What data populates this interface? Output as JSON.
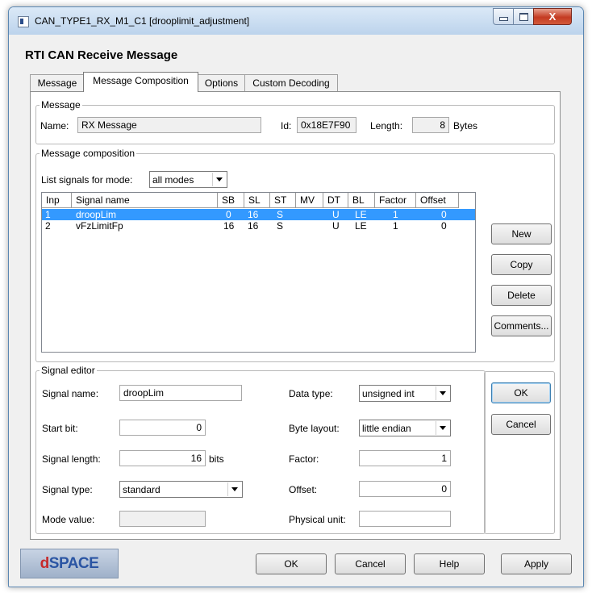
{
  "window": {
    "title": "CAN_TYPE1_RX_M1_C1  [drooplimit_adjustment]",
    "close_glyph": "X"
  },
  "heading": "RTI CAN  Receive Message",
  "tabs": [
    {
      "label": "Message"
    },
    {
      "label": "Message Composition",
      "active": true
    },
    {
      "label": "Options"
    },
    {
      "label": "Custom Decoding"
    }
  ],
  "message_group": {
    "legend": "Message",
    "name_label": "Name:",
    "name_value": "RX Message",
    "id_label": "Id:",
    "id_value": "0x18E7F90",
    "length_label": "Length:",
    "length_value": "8",
    "bytes_label": "Bytes"
  },
  "composition_group": {
    "legend": "Message composition",
    "mode_label": "List signals for mode:",
    "mode_value": "all modes",
    "columns": [
      "Inp",
      "Signal name",
      "SB",
      "SL",
      "ST",
      "MV",
      "DT",
      "BL",
      "Factor",
      "Offset"
    ],
    "rows": [
      {
        "inp": "1",
        "name": "droopLim",
        "sb": "0",
        "sl": "16",
        "st": "S",
        "mv": "",
        "dt": "U",
        "bl": "LE",
        "factor": "1",
        "offset": "0",
        "selected": true
      },
      {
        "inp": "2",
        "name": "vFzLimitFp",
        "sb": "16",
        "sl": "16",
        "st": "S",
        "mv": "",
        "dt": "U",
        "bl": "LE",
        "factor": "1",
        "offset": "0",
        "selected": false
      }
    ],
    "buttons": {
      "new": "New",
      "copy": "Copy",
      "delete": "Delete",
      "comments": "Comments..."
    }
  },
  "signal_editor": {
    "legend": "Signal editor",
    "signal_name_label": "Signal name:",
    "signal_name_value": "droopLim",
    "start_bit_label": "Start bit:",
    "start_bit_value": "0",
    "signal_length_label": "Signal length:",
    "signal_length_value": "16",
    "bits_label": "bits",
    "signal_type_label": "Signal type:",
    "signal_type_value": "standard",
    "mode_value_label": "Mode value:",
    "mode_value_value": "",
    "data_type_label": "Data type:",
    "data_type_value": "unsigned int",
    "byte_layout_label": "Byte layout:",
    "byte_layout_value": "little endian",
    "factor_label": "Factor:",
    "factor_value": "1",
    "offset_label": "Offset:",
    "offset_value": "0",
    "physical_unit_label": "Physical unit:",
    "physical_unit_value": "",
    "ok": "OK",
    "cancel": "Cancel"
  },
  "footer": {
    "logo": "dSPACE",
    "logo_d": "d",
    "logo_rest": "SPACE",
    "ok": "OK",
    "cancel": "Cancel",
    "help": "Help",
    "apply": "Apply"
  },
  "colors": {
    "selection": "#3399ff",
    "close_button": "#c43b22",
    "logo_blue": "#2b55a3",
    "logo_red": "#c62a2a"
  }
}
